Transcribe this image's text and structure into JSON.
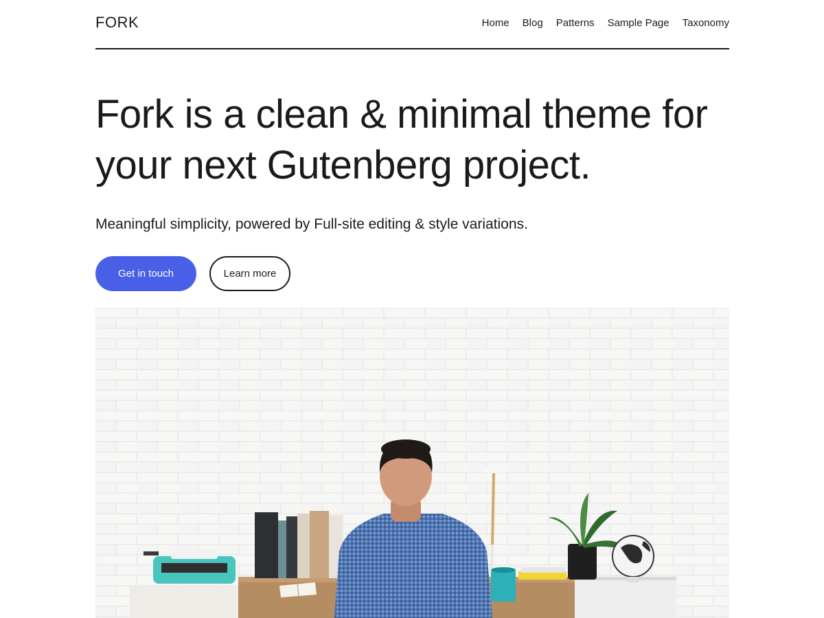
{
  "header": {
    "site_title": "FORK",
    "nav": [
      {
        "label": "Home"
      },
      {
        "label": "Blog"
      },
      {
        "label": "Patterns"
      },
      {
        "label": "Sample Page"
      },
      {
        "label": "Taxonomy"
      }
    ]
  },
  "hero": {
    "headline_line1": "Fork is a clean & minimal theme for",
    "headline_line2": "your next Gutenberg project.",
    "tagline": "Meaningful simplicity, powered by Full-site editing & style variations.",
    "primary_button": "Get in touch",
    "secondary_button": "Learn more"
  },
  "colors": {
    "accent": "#4a5fe8",
    "text": "#1a1a1a",
    "background": "#ffffff"
  }
}
